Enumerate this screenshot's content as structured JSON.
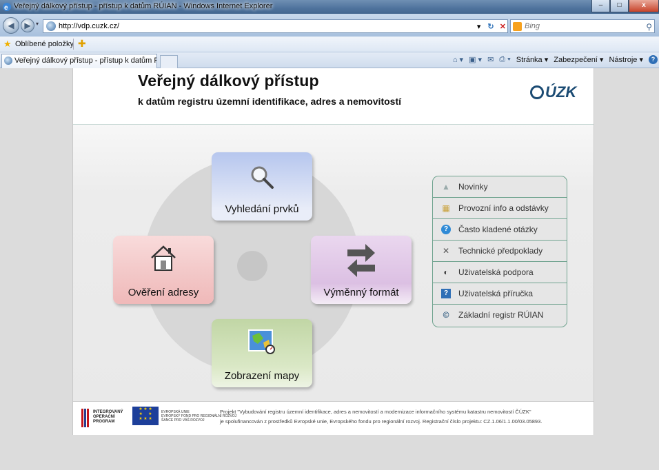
{
  "window": {
    "title": "Veřejný dálkový přístup - přístup k datům RÚIAN - Windows Internet Explorer",
    "minimize": "–",
    "maximize": "□",
    "close": "x"
  },
  "addressbar": {
    "url": "http://vdp.cuzk.cz/",
    "search_placeholder": "Bing"
  },
  "favorites": {
    "label": "Oblíbené položky"
  },
  "tab": {
    "label": "Veřejný dálkový přístup - přístup k datům RÚIAN"
  },
  "commandbar": {
    "page": "Stránka ▾",
    "safety": "Zabezpečení ▾",
    "tools": "Nástroje ▾"
  },
  "header": {
    "title": "Veřejný dálkový přístup",
    "subtitle": "k datům registru územní identifikace, adres a nemovitostí",
    "logo_text": "ÚZK"
  },
  "tiles": {
    "search": "Vyhledání prvků",
    "address": "Ověření adresy",
    "exchange": "Výměnný formát",
    "map": "Zobrazení mapy"
  },
  "info_links": [
    "Novinky",
    "Provozní info a odstávky",
    "Často kladené otázky",
    "Technické předpoklady",
    "Uživatelská podpora",
    "Uživatelská příručka",
    "Základní registr RÚIAN"
  ],
  "footer": {
    "iop_logo": "INTEGROVANÝ\nOPERAČNÍ\nPROGRAM",
    "eu_logo": "EVROPSKÁ UNIE\nEVROPSKÝ FOND PRO REGIONÁLNÍ ROZVOJ\nŠANCE PRO VÁŠ ROZVOJ",
    "line1": "Projekt \"Vybudování registru územní identifikace, adres a nemovitostí a modernizace informačního systému katastru nemovitostí ČÚZK\"",
    "line2": "je spolufinancován z prostředků Evropské unie, Evropského fondu pro regionální rozvoj. Registrační číslo projektu: CZ.1.06/1.1.00/03.05893."
  }
}
